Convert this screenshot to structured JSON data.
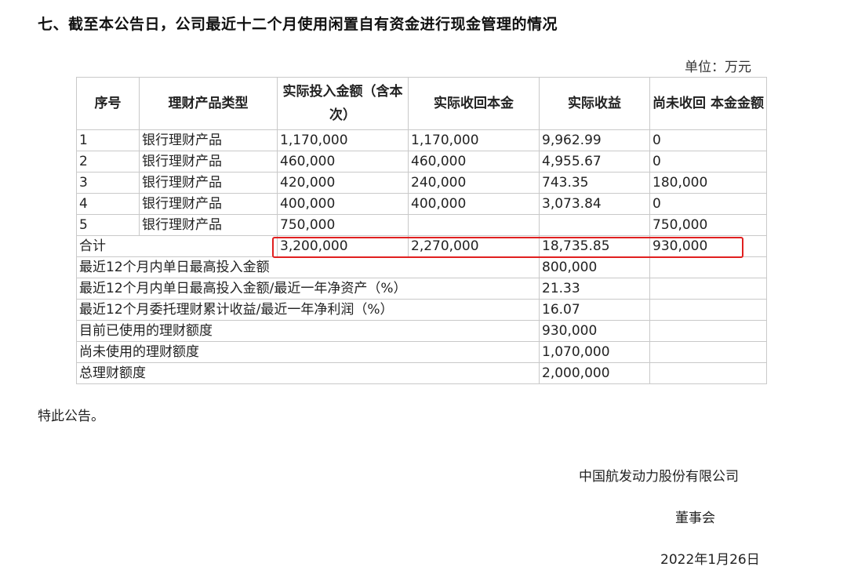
{
  "heading": "七、截至本公告日，公司最近十二个月使用闲置自有资金进行现金管理的情况",
  "unit": "单位：万元",
  "table": {
    "headers": [
      "序号",
      "理财产品类型",
      "实际投入金额（含本次）",
      "实际收回本金",
      "实际收益",
      "尚未收回 本金金额"
    ],
    "rows": [
      [
        "1",
        "银行理财产品",
        "1,170,000",
        "1,170,000",
        "9,962.99",
        "0"
      ],
      [
        "2",
        "银行理财产品",
        "460,000",
        "460,000",
        "4,955.67",
        "0"
      ],
      [
        "3",
        "银行理财产品",
        "420,000",
        "240,000",
        "743.35",
        "180,000"
      ],
      [
        "4",
        "银行理财产品",
        "400,000",
        "400,000",
        "3,073.84",
        "0"
      ],
      [
        "5",
        "银行理财产品",
        "750,000",
        "",
        "",
        "750,000"
      ]
    ],
    "total": {
      "label": "合计",
      "invested": "3,200,000",
      "recovered": "2,270,000",
      "income": "18,735.85",
      "unrecovered": "930,000"
    },
    "summary": [
      {
        "label": "最近12个月内单日最高投入金额",
        "value": "800,000"
      },
      {
        "label": "最近12个月内单日最高投入金额/最近一年净资产（%）",
        "value": "21.33"
      },
      {
        "label": "最近12个月委托理财累计收益/最近一年净利润（%）",
        "value": "16.07"
      },
      {
        "label": "目前已使用的理财额度",
        "value": "930,000"
      },
      {
        "label": "尚未使用的理财额度",
        "value": "1,070,000"
      },
      {
        "label": "总理财额度",
        "value": "2,000,000"
      }
    ]
  },
  "closing": "特此公告。",
  "signature": {
    "company": "中国航发动力股份有限公司",
    "board": "董事会",
    "date": "2022年1月26日"
  }
}
